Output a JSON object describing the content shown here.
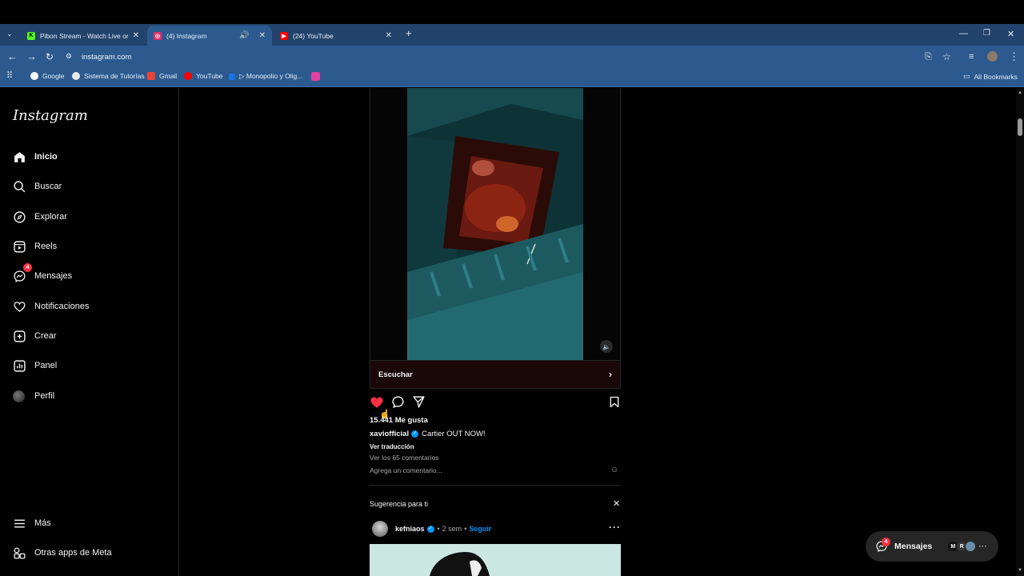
{
  "browser": {
    "tabs": [
      {
        "title": "Pibon Stream - Watch Live on K",
        "favicon": "kick-icon",
        "color": "#53fc18"
      },
      {
        "title": "(4) Instagram",
        "favicon": "instagram-icon",
        "color": "#e1306c"
      },
      {
        "title": "(24) YouTube",
        "favicon": "youtube-icon",
        "color": "#ff0000"
      }
    ],
    "url": "instagram.com",
    "bookmarks": [
      {
        "label": "Google",
        "color": "#ffffff"
      },
      {
        "label": "Sistema de Tutorías",
        "color": "#e8e8e8"
      },
      {
        "label": "Gmail",
        "color": "#ea4335"
      },
      {
        "label": "YouTube",
        "color": "#ff0000"
      },
      {
        "label": "▷ Monopolio y Olig...",
        "color": "#1a73e8"
      },
      {
        "label": "",
        "color": "#e040a0"
      }
    ],
    "all_bookmarks": "All Bookmarks"
  },
  "sidebar": {
    "logo": "Instagram",
    "items": [
      {
        "label": "Inicio",
        "icon": "home-icon"
      },
      {
        "label": "Buscar",
        "icon": "search-icon"
      },
      {
        "label": "Explorar",
        "icon": "compass-icon"
      },
      {
        "label": "Reels",
        "icon": "reels-icon"
      },
      {
        "label": "Mensajes",
        "icon": "messenger-icon",
        "badge": "4"
      },
      {
        "label": "Notificaciones",
        "icon": "heart-icon"
      },
      {
        "label": "Crear",
        "icon": "plus-square-icon"
      },
      {
        "label": "Panel",
        "icon": "dashboard-icon"
      },
      {
        "label": "Perfil",
        "icon": "avatar"
      }
    ],
    "more": "Más",
    "meta_apps": "Otras apps de Meta"
  },
  "post": {
    "escuchar": "Escuchar",
    "likes": "15.441 Me gusta",
    "username": "xaviofficial",
    "caption": "Cartier OUT NOW!",
    "translate": "Ver traducción",
    "comments_link": "Ver los 65 comentarios",
    "comment_placeholder": "Agrega un comentario...",
    "liked": true,
    "like_color": "#ff3040"
  },
  "suggestion": {
    "title": "Sugerencia para ti",
    "username": "kefniaos",
    "time": "2 sem",
    "follow": "Seguir",
    "follow_color": "#0095f6"
  },
  "messages_pill": {
    "label": "Mensajes",
    "badge": "4",
    "avatars": [
      "M",
      "R",
      ""
    ]
  }
}
